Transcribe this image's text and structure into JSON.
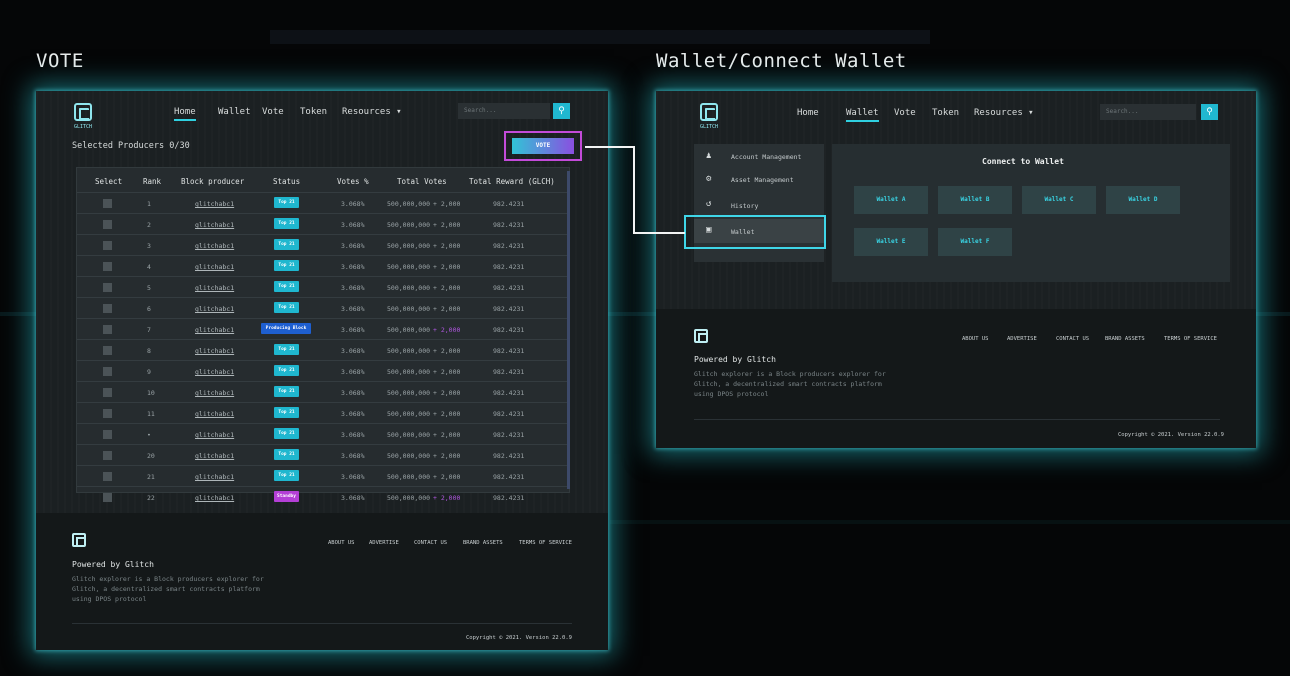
{
  "headings": {
    "left": "VOTE",
    "right": "Wallet/Connect Wallet"
  },
  "nav": {
    "logo_text": "GLITCH",
    "items": [
      "Home",
      "Wallet",
      "Vote",
      "Token",
      "Resources ▾"
    ],
    "search_placeholder": "Search...",
    "search_icon": "search-icon"
  },
  "vote_page": {
    "selected_producers": "Selected Producers  0/30",
    "vote_button": "VOTE",
    "table": {
      "headers": [
        "Select",
        "Rank",
        "Block producer",
        "Status",
        "Votes %",
        "Total Votes",
        "Total Reward (GLCH)"
      ],
      "rows": [
        {
          "rank": "1",
          "producer": "glitchabc1",
          "status": "Top 21",
          "status_kind": "top",
          "votes_pct": "3.068%",
          "total_votes": "500,000,000",
          "plus": "+ 2,000",
          "reward": "982.4231"
        },
        {
          "rank": "2",
          "producer": "glitchabc1",
          "status": "Top 21",
          "status_kind": "top",
          "votes_pct": "3.068%",
          "total_votes": "500,000,000",
          "plus": "+ 2,000",
          "reward": "982.4231"
        },
        {
          "rank": "3",
          "producer": "glitchabc1",
          "status": "Top 21",
          "status_kind": "top",
          "votes_pct": "3.068%",
          "total_votes": "500,000,000",
          "plus": "+ 2,000",
          "reward": "982.4231"
        },
        {
          "rank": "4",
          "producer": "glitchabc1",
          "status": "Top 21",
          "status_kind": "top",
          "votes_pct": "3.068%",
          "total_votes": "500,000,000",
          "plus": "+ 2,000",
          "reward": "982.4231"
        },
        {
          "rank": "5",
          "producer": "glitchabc1",
          "status": "Top 21",
          "status_kind": "top",
          "votes_pct": "3.068%",
          "total_votes": "500,000,000",
          "plus": "+ 2,000",
          "reward": "982.4231"
        },
        {
          "rank": "6",
          "producer": "glitchabc1",
          "status": "Top 21",
          "status_kind": "top",
          "votes_pct": "3.068%",
          "total_votes": "500,000,000",
          "plus": "+ 2,000",
          "reward": "982.4231"
        },
        {
          "rank": "7",
          "producer": "glitchabc1",
          "status": "Producing Block",
          "status_kind": "prod",
          "votes_pct": "3.068%",
          "total_votes": "500,000,000",
          "plus": "+ 2,000",
          "reward": "982.4231"
        },
        {
          "rank": "8",
          "producer": "glitchabc1",
          "status": "Top 21",
          "status_kind": "top",
          "votes_pct": "3.068%",
          "total_votes": "500,000,000",
          "plus": "+ 2,000",
          "reward": "982.4231"
        },
        {
          "rank": "9",
          "producer": "glitchabc1",
          "status": "Top 21",
          "status_kind": "top",
          "votes_pct": "3.068%",
          "total_votes": "500,000,000",
          "plus": "+ 2,000",
          "reward": "982.4231"
        },
        {
          "rank": "10",
          "producer": "glitchabc1",
          "status": "Top 21",
          "status_kind": "top",
          "votes_pct": "3.068%",
          "total_votes": "500,000,000",
          "plus": "+ 2,000",
          "reward": "982.4231"
        },
        {
          "rank": "11",
          "producer": "glitchabc1",
          "status": "Top 21",
          "status_kind": "top",
          "votes_pct": "3.068%",
          "total_votes": "500,000,000",
          "plus": "+ 2,000",
          "reward": "982.4231"
        },
        {
          "rank": "•",
          "producer": "glitchabc1",
          "status": "Top 21",
          "status_kind": "top",
          "votes_pct": "3.068%",
          "total_votes": "500,000,000",
          "plus": "+ 2,000",
          "reward": "982.4231"
        },
        {
          "rank": "20",
          "producer": "glitchabc1",
          "status": "Top 21",
          "status_kind": "top",
          "votes_pct": "3.068%",
          "total_votes": "500,000,000",
          "plus": "+ 2,000",
          "reward": "982.4231"
        },
        {
          "rank": "21",
          "producer": "glitchabc1",
          "status": "Top 21",
          "status_kind": "top",
          "votes_pct": "3.068%",
          "total_votes": "500,000,000",
          "plus": "+ 2,000",
          "reward": "982.4231"
        },
        {
          "rank": "22",
          "producer": "glitchabc1",
          "status": "Standby",
          "status_kind": "stand",
          "votes_pct": "3.068%",
          "total_votes": "500,000,000",
          "plus": "+ 2,000",
          "reward": "982.4231"
        }
      ]
    }
  },
  "wallet_page": {
    "sidebar": [
      {
        "label": "Account Management",
        "icon": "user-gear-icon"
      },
      {
        "label": "Asset Management",
        "icon": "gear-icon"
      },
      {
        "label": "History",
        "icon": "history-icon"
      },
      {
        "label": "Wallet",
        "icon": "wallet-icon"
      }
    ],
    "connect_title": "Connect to Wallet",
    "wallets": [
      "Wallet A",
      "Wallet B",
      "Wallet C",
      "Wallet D",
      "Wallet E",
      "Wallet F"
    ]
  },
  "footer": {
    "powered": "Powered by Glitch",
    "description": "Glitch explorer is a Block producers explorer for Glitch, a decentralized smart contracts platform using DPOS protocol",
    "links": [
      "ABOUT US",
      "ADVERTISE",
      "CONTACT US",
      "BRAND ASSETS",
      "TERMS OF SERVICE"
    ],
    "copyright": "Copyright © 2021. Version 22.0.9"
  },
  "colors": {
    "accent": "#2fd0e0",
    "vote_highlight": "#c34bd9",
    "wallet_highlight": "#3fd6e8"
  }
}
